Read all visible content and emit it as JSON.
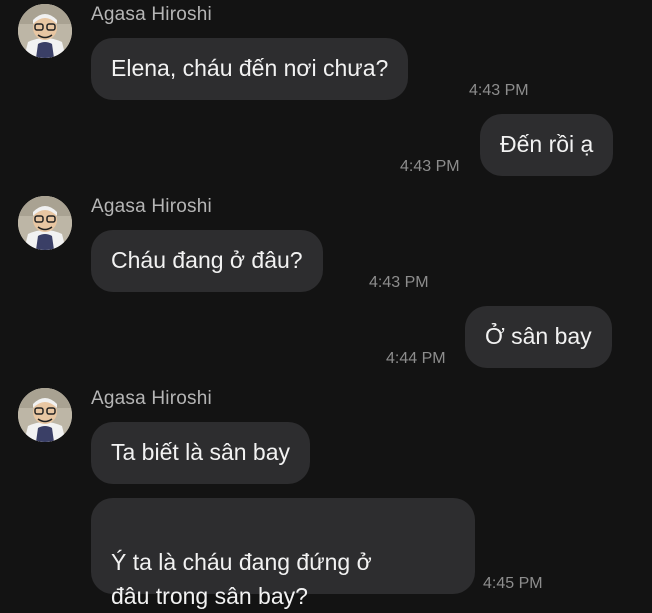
{
  "conversation": {
    "contact_name": "Agasa Hiroshi",
    "avatar_icon": "agasa-avatar-icon",
    "groups": [
      {
        "sender": "Agasa Hiroshi",
        "messages": [
          {
            "text": "Elena, cháu đến nơi chưa?",
            "time": "4:43 PM",
            "direction": "incoming"
          }
        ]
      },
      {
        "sender": "me",
        "messages": [
          {
            "text": "Đến rồi ạ",
            "time": "4:43 PM",
            "direction": "outgoing"
          }
        ]
      },
      {
        "sender": "Agasa Hiroshi",
        "messages": [
          {
            "text": "Cháu đang ở đâu?",
            "time": "4:43 PM",
            "direction": "incoming"
          }
        ]
      },
      {
        "sender": "me",
        "messages": [
          {
            "text": "Ở sân bay",
            "time": "4:44 PM",
            "direction": "outgoing"
          }
        ]
      },
      {
        "sender": "Agasa Hiroshi",
        "messages": [
          {
            "text": "Ta biết là sân bay",
            "time": "",
            "direction": "incoming"
          },
          {
            "text": "Ý ta là cháu đang đứng ở\nđâu trong sân bay?",
            "time": "4:45 PM",
            "direction": "incoming"
          }
        ]
      }
    ]
  },
  "colors": {
    "background": "#131313",
    "bubble": "#2d2d2f",
    "text": "#f2f2f2",
    "sender_name": "#b5b5b5",
    "timestamp": "#8d8d8d"
  }
}
